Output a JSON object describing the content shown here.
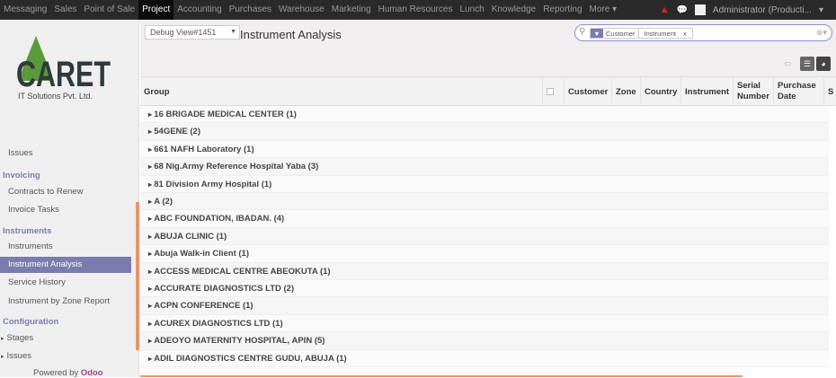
{
  "topbar": {
    "menu": [
      "Messaging",
      "Sales",
      "Point of Sale",
      "Project",
      "Accounting",
      "Purchases",
      "Warehouse",
      "Marketing",
      "Human Resources",
      "Lunch",
      "Knowledge",
      "Reporting",
      "More ▾"
    ],
    "active": "Project",
    "user": "Administrator (Producti..."
  },
  "sidebar": {
    "logo_text": "CARET",
    "logo_sub": "IT Solutions Pvt. Ltd.",
    "partial_item": "Issues",
    "sections": [
      {
        "title": "Invoicing",
        "items": [
          "Contracts to Renew",
          "Invoice Tasks"
        ]
      },
      {
        "title": "Instruments",
        "items": [
          "Instruments",
          "Instrument Analysis",
          "Service History",
          "Instrument by Zone Report"
        ]
      },
      {
        "title": "Configuration",
        "items": [
          "Stages",
          "Issues"
        ]
      }
    ],
    "selected": "Instrument Analysis",
    "powered_by": "Powered by",
    "powered_brand": "Odoo"
  },
  "header": {
    "debug": "Debug View#1451",
    "title": "Instrument Analysis",
    "facets": [
      "Customer",
      "Instrument"
    ],
    "facet_close": "x"
  },
  "table": {
    "columns": [
      "Group",
      "Customer",
      "Zone",
      "Country",
      "Instrument",
      "Serial Number",
      "Purchase Date",
      "S"
    ],
    "groups": [
      "16 BRIGADE MEDICAL CENTER (1)",
      "54GENE (2)",
      "661 NAFH Laboratory (1)",
      "68 Nig.Army Reference Hospital Yaba (3)",
      "81 Division Army Hospital (1)",
      "A (2)",
      "ABC FOUNDATION, IBADAN. (4)",
      "ABUJA CLINIC (1)",
      "Abuja Walk-in Client (1)",
      "ACCESS MEDICAL CENTRE ABEOKUTA (1)",
      "ACCURATE DIAGNOSTICS LTD (2)",
      "ACPN CONFERENCE (1)",
      "ACUREX DIAGNOSTICS LTD (1)",
      "ADEOYO MATERNITY HOSPITAL, APIN (5)",
      "ADIL DIAGNOSTICS CENTRE GUDU, ABUJA (1)"
    ]
  },
  "colors": {
    "accent": "#7c7bad",
    "topbar": "#2a2a2a",
    "logo_green": "#5a9a3c"
  }
}
